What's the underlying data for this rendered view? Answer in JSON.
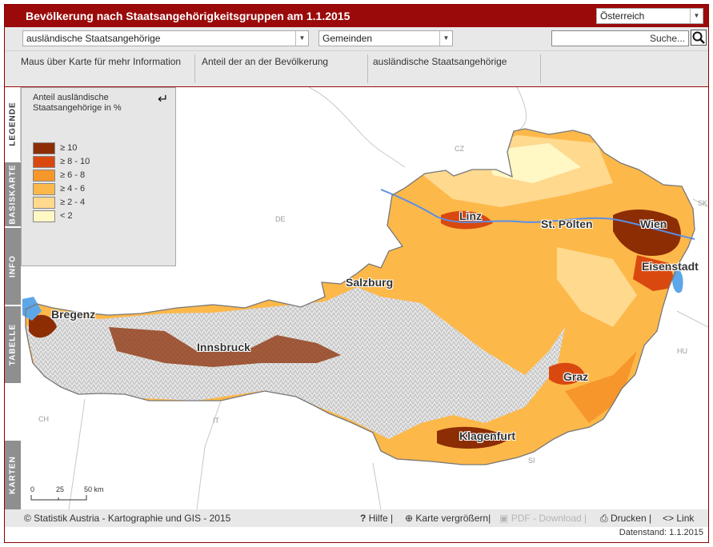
{
  "header": {
    "title": "Bevölkerung nach Staatsangehörigkeitsgruppen am 1.1.2015",
    "region_select": "Österreich"
  },
  "toolbar": {
    "indicator_select": "ausländische Staatsangehörige",
    "level_select": "Gemeinden",
    "search_placeholder": "Suche..."
  },
  "infobar": {
    "hint": "Maus über Karte für mehr Information",
    "col2": "Anteil der an der Bevölkerung",
    "col3": "ausländische Staatsangehörige"
  },
  "sidetabs": [
    "LEGENDE",
    "BASISKARTE",
    "INFO",
    "TABELLE",
    "KARTEN"
  ],
  "legend": {
    "title": "Anteil ausländische Staatsangehörige in %",
    "classes": [
      {
        "label": "≥ 10",
        "color": "#8c2d04"
      },
      {
        "label": "≥ 8 - 10",
        "color": "#d9480f"
      },
      {
        "label": "≥ 6 - 8",
        "color": "#f7962a"
      },
      {
        "label": "≥ 4 - 6",
        "color": "#fdb84a"
      },
      {
        "label": "≥ 2 - 4",
        "color": "#fed98e"
      },
      {
        "label": "< 2",
        "color": "#fff7c4"
      }
    ]
  },
  "map": {
    "cities": [
      "Linz",
      "St. Pölten",
      "Wien",
      "Eisenstadt",
      "Salzburg",
      "Bregenz",
      "Innsbruck",
      "Graz",
      "Klagenfurt"
    ],
    "countries": [
      "CZ",
      "SK",
      "DE",
      "HU",
      "CH",
      "IT",
      "SI"
    ],
    "scale": {
      "ticks": [
        "0",
        "25",
        "50 km"
      ]
    }
  },
  "footer": {
    "copyright": "© Statistik Austria  - Kartographie und GIS - 2015",
    "help": "Hilfe",
    "enlarge": "Karte vergrößern",
    "pdf": "PDF - Download",
    "print": "Drucken",
    "link": "Link",
    "datenstand": "Datenstand: 1.1.2015"
  }
}
